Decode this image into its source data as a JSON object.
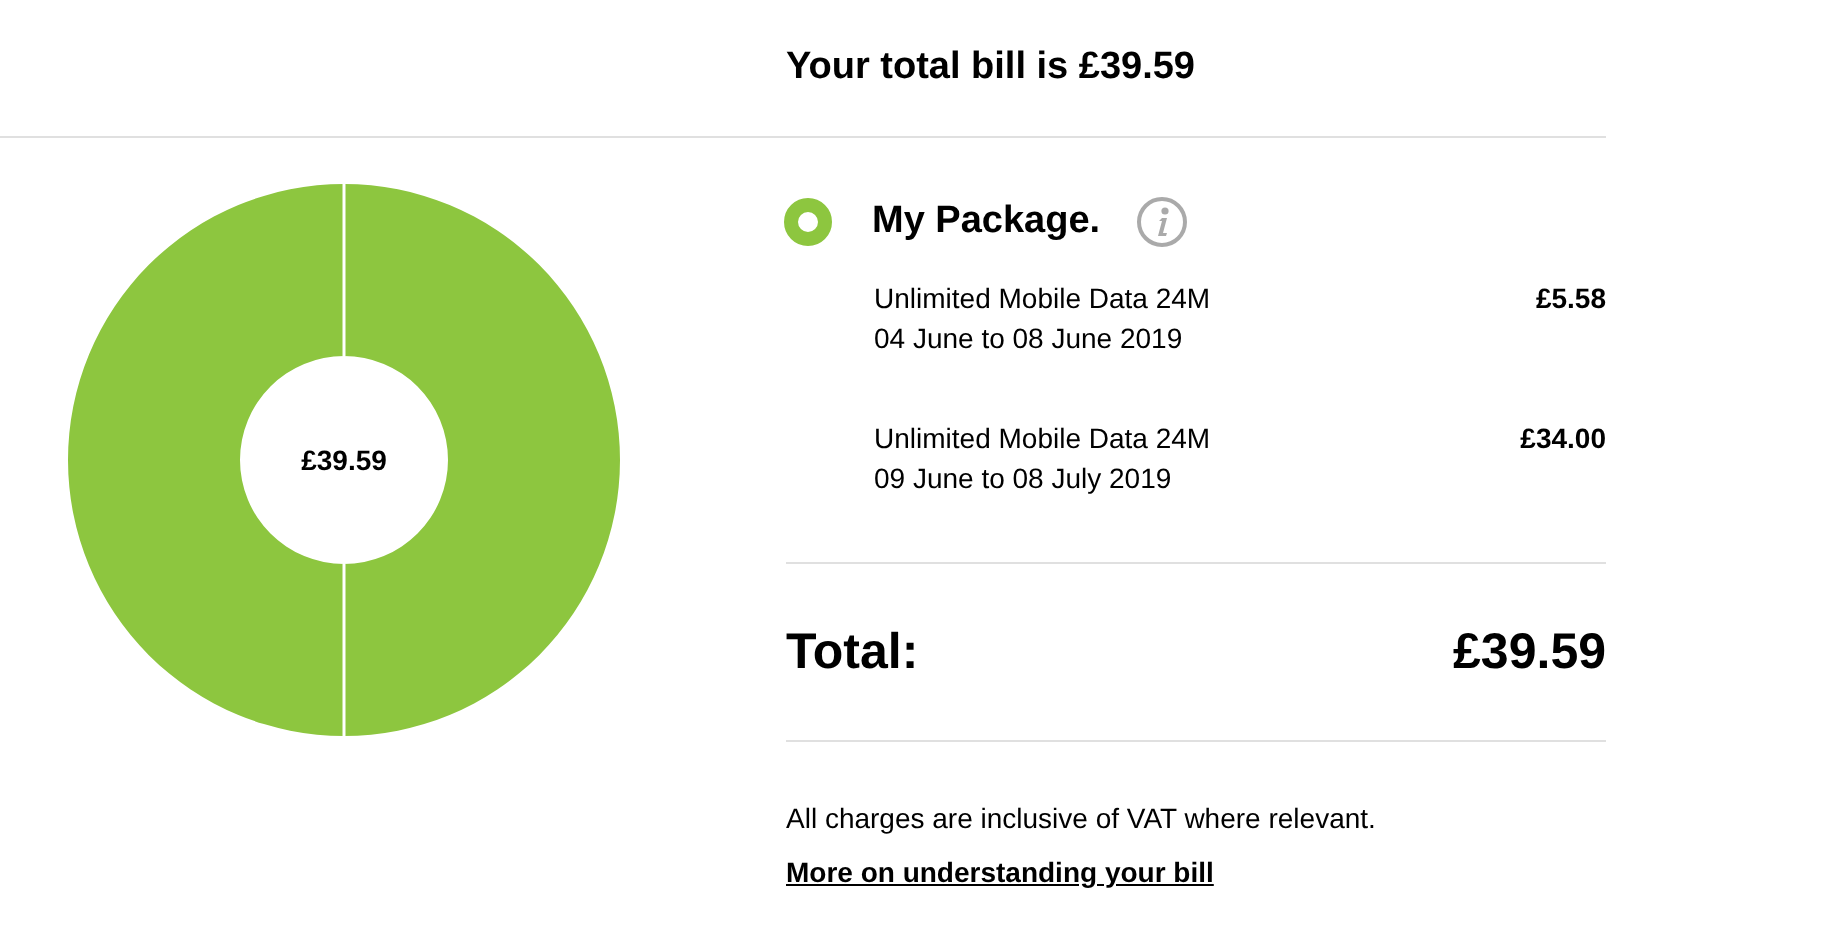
{
  "header": {
    "title": "Your total bill is £39.59"
  },
  "donut": {
    "center_label": "£39.59"
  },
  "package": {
    "title": "My Package.",
    "color": "#8dc63f",
    "selected": true,
    "items": [
      {
        "name": "Unlimited Mobile Data 24M",
        "period": "04 June to 08 June 2019",
        "amount": "£5.58"
      },
      {
        "name": "Unlimited Mobile Data 24M",
        "period": "09 June to 08 July 2019",
        "amount": "£34.00"
      }
    ]
  },
  "total": {
    "label": "Total:",
    "amount": "£39.59"
  },
  "note": "All charges are inclusive of VAT where relevant.",
  "link": "More on understanding your bill"
}
